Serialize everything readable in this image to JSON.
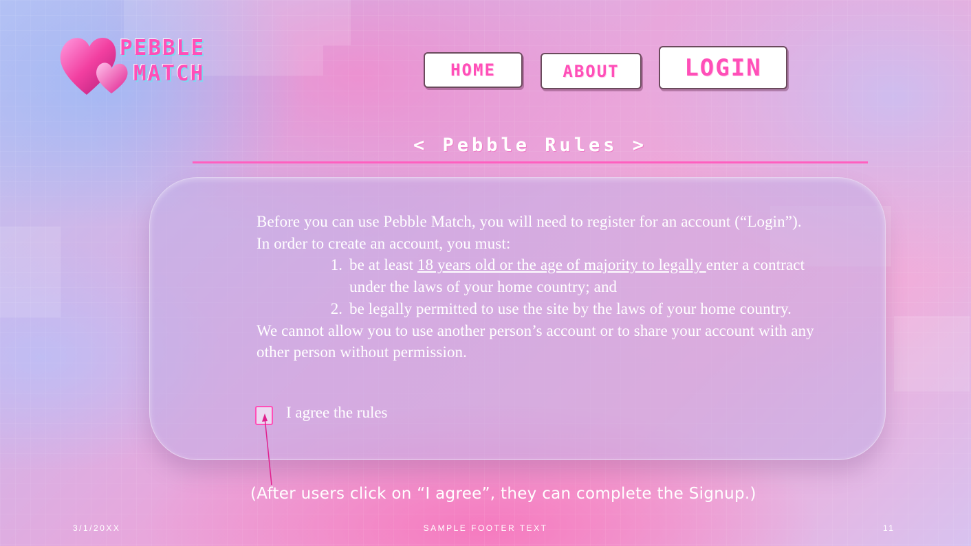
{
  "brand": {
    "line1": "PEBBLE",
    "line2": "MATCH",
    "logo_icon": "hearts-icon"
  },
  "nav": {
    "home": "Home",
    "about": "About",
    "login": "Login"
  },
  "section": {
    "title": "< Pebble Rules >"
  },
  "rules": {
    "intro_1": "Before you can use Pebble Match, you will need to register for an account (“Login”).",
    "intro_2": "In order to create an account, you must:",
    "item1_prefix": "be at least ",
    "item1_link": "18 years old or the age of majority to legally ",
    "item1_suffix": "enter a contract under the laws of your home country; and",
    "item2": "be legally permitted to use the site by the laws of your home country.",
    "outro": "We cannot allow you to use another person’s account or to share your account with any other person without permission."
  },
  "agree": {
    "label": "I agree the rules",
    "checked": false
  },
  "note": "(After users click on “I agree”, they can complete the Signup.)",
  "footer": {
    "date": "3/1/20XX",
    "text": "SAMPLE FOOTER TEXT",
    "page": "11"
  },
  "colors": {
    "accent": "#ff4fb8",
    "text": "#ffffff",
    "card": "#c3afe6"
  }
}
